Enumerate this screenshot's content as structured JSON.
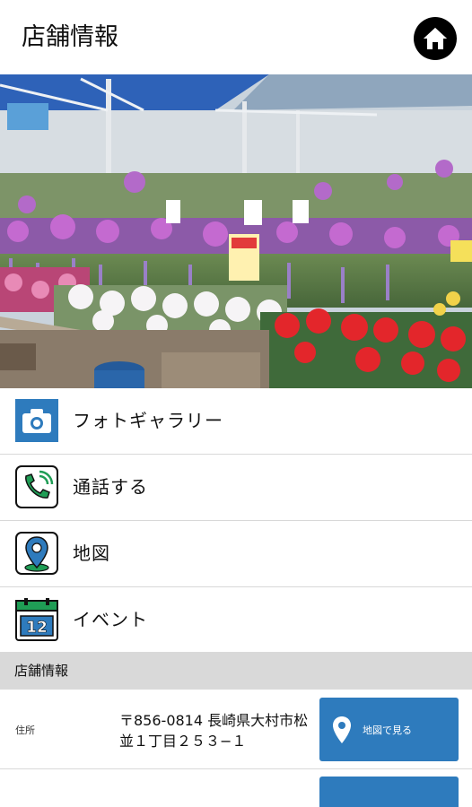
{
  "header": {
    "title": "店舗情報",
    "home_icon": "home-icon"
  },
  "hero": {
    "alt": "garden-center-photo"
  },
  "menu": {
    "items": [
      {
        "label": "フォトギャラリー",
        "icon": "camera-icon"
      },
      {
        "label": "通話する",
        "icon": "phone-icon"
      },
      {
        "label": "地図",
        "icon": "map-pin-icon"
      },
      {
        "label": "イベント",
        "icon": "calendar-icon",
        "icon_text": "12"
      }
    ]
  },
  "store_info": {
    "section_title": "店舗情報",
    "address_label": "住所",
    "address_value": "〒856-0814 長崎県大村市松並１丁目２５３−１",
    "map_button_label": "地図で見る"
  },
  "colors": {
    "accent": "#2e7bbd",
    "section_bg": "#d9d9d9",
    "icon_green": "#1f9d55"
  }
}
